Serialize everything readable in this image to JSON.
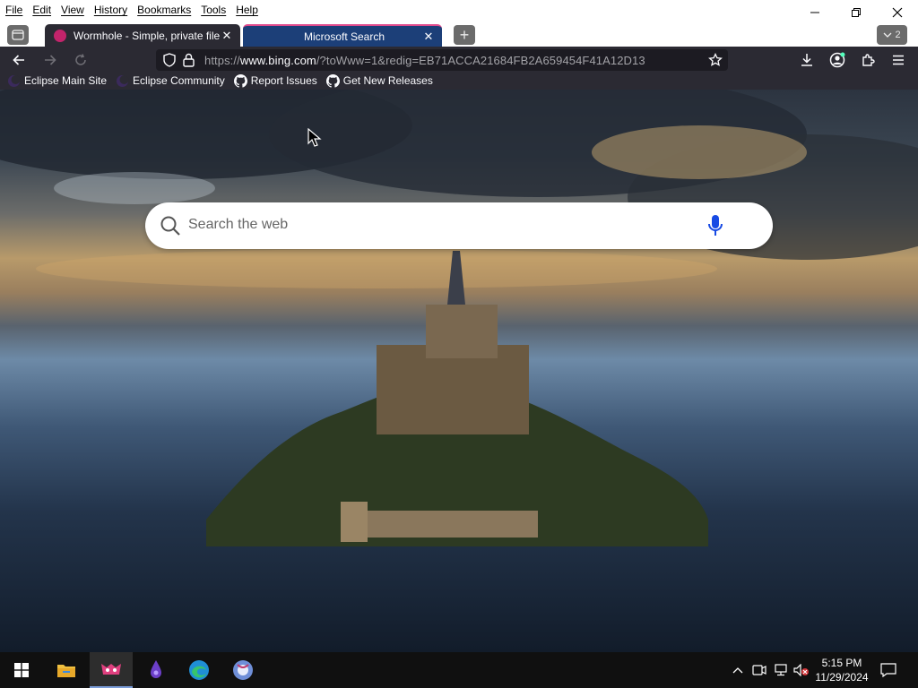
{
  "menu": {
    "items": [
      "File",
      "Edit",
      "View",
      "History",
      "Bookmarks",
      "Tools",
      "Help"
    ]
  },
  "tabs": [
    {
      "title": "Wormhole - Simple, private file",
      "icon": "wormhole-icon",
      "active": false
    },
    {
      "title": "Microsoft Search",
      "icon": "bing-icon",
      "active": true
    }
  ],
  "tab_count": "2",
  "urlbar": {
    "scheme": "https://",
    "host": "www.bing.com",
    "path": "/?toWww=1&redig=EB71ACCA21684FB2A659454F41A12D13"
  },
  "bookmarks": [
    {
      "label": "Eclipse Main Site",
      "icon": "eclipse-icon"
    },
    {
      "label": "Eclipse Community",
      "icon": "eclipse-icon"
    },
    {
      "label": "Report Issues",
      "icon": "github-icon"
    },
    {
      "label": "Get New Releases",
      "icon": "github-icon"
    }
  ],
  "search": {
    "placeholder": "Search the web"
  },
  "taskbar": {
    "time": "5:15 PM",
    "date": "11/29/2024",
    "apps": [
      "file-explorer-icon",
      "wormhole-app-icon",
      "eclipse-app-icon",
      "edge-icon",
      "other-browser-icon"
    ]
  },
  "colors": {
    "toolbar": "#2b2a33",
    "active_tab": "#1c3f78",
    "tab_accent": "#e04a8c"
  }
}
